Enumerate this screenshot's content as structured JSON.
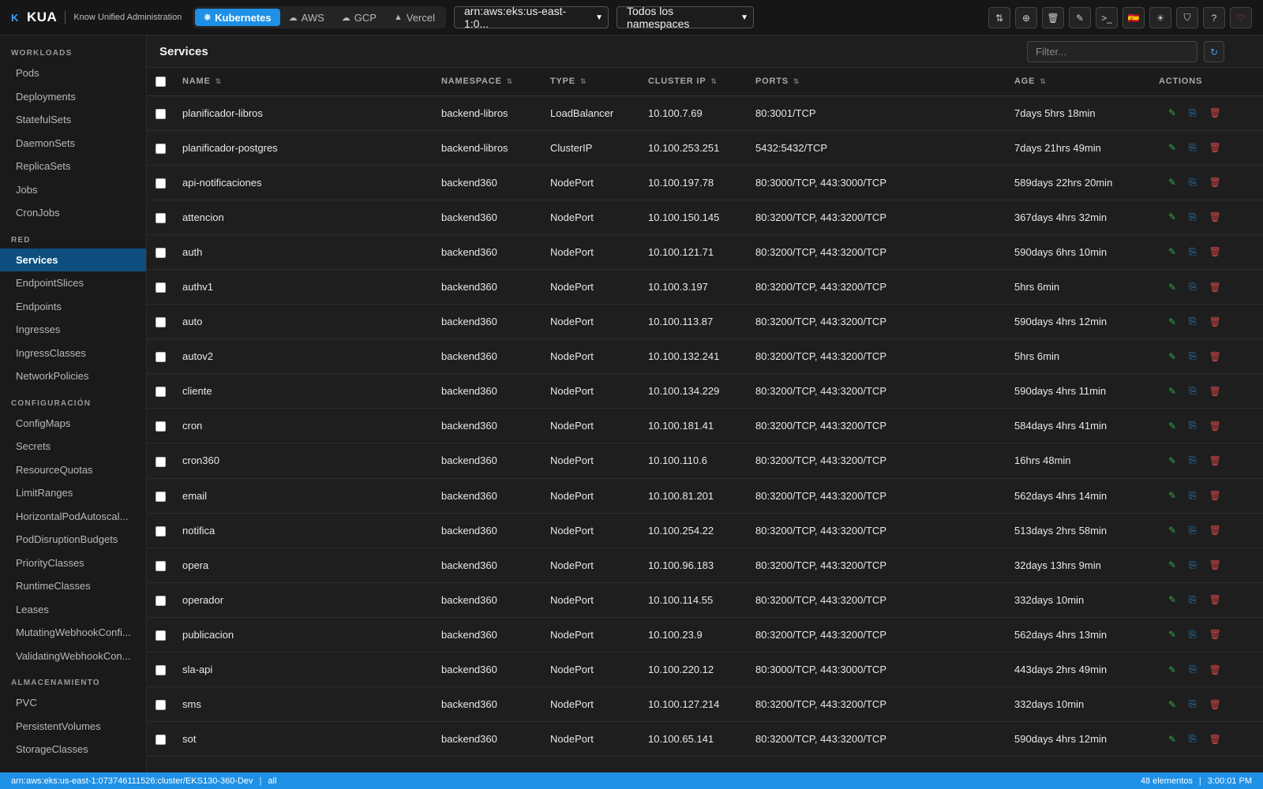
{
  "app": {
    "logo": "K",
    "name": "KUA",
    "subtitle": "Know Unified Administration"
  },
  "providers": [
    {
      "label": "Kubernetes",
      "icon": "⎈"
    },
    {
      "label": "AWS",
      "icon": "☁"
    },
    {
      "label": "GCP",
      "icon": "☁"
    },
    {
      "label": "Vercel",
      "icon": "▲"
    }
  ],
  "cluster_select": "arn:aws:eks:us-east-1:0...",
  "namespace_select": "Todos los namespaces",
  "toolbar_icons": [
    "⇅",
    "⊕",
    "🗑",
    "✎",
    ">_",
    "🇪🇸",
    "☀",
    "⛉",
    "?",
    "♡"
  ],
  "sidebar": {
    "sections": [
      {
        "title": "WORKLOADS",
        "items": [
          "Pods",
          "Deployments",
          "StatefulSets",
          "DaemonSets",
          "ReplicaSets",
          "Jobs",
          "CronJobs"
        ]
      },
      {
        "title": "RED",
        "items": [
          "Services",
          "EndpointSlices",
          "Endpoints",
          "Ingresses",
          "IngressClasses",
          "NetworkPolicies"
        ]
      },
      {
        "title": "CONFIGURACIÓN",
        "items": [
          "ConfigMaps",
          "Secrets",
          "ResourceQuotas",
          "LimitRanges",
          "HorizontalPodAutoscal...",
          "PodDisruptionBudgets",
          "PriorityClasses",
          "RuntimeClasses",
          "Leases",
          "MutatingWebhookConfi...",
          "ValidatingWebhookCon..."
        ]
      },
      {
        "title": "ALMACENAMIENTO",
        "items": [
          "PVC",
          "PersistentVolumes",
          "StorageClasses"
        ]
      }
    ],
    "active": "Services"
  },
  "main": {
    "title": "Services",
    "filter_placeholder": "Filter...",
    "refresh_icon": "↻"
  },
  "table": {
    "columns": [
      "NAME",
      "NAMESPACE",
      "TYPE",
      "CLUSTER IP",
      "PORTS",
      "AGE",
      "ACTIONS"
    ],
    "sort_icon": "⇅",
    "action_icons": {
      "edit": "✎",
      "describe": "⎘",
      "delete": "🗑"
    },
    "rows": [
      {
        "name": "planificador-libros",
        "namespace": "backend-libros",
        "type": "LoadBalancer",
        "ip": "10.100.7.69",
        "ports": "80:3001/TCP",
        "age": "7days 5hrs 18min"
      },
      {
        "name": "planificador-postgres",
        "namespace": "backend-libros",
        "type": "ClusterIP",
        "ip": "10.100.253.251",
        "ports": "5432:5432/TCP",
        "age": "7days 21hrs 49min"
      },
      {
        "name": "api-notificaciones",
        "namespace": "backend360",
        "type": "NodePort",
        "ip": "10.100.197.78",
        "ports": "80:3000/TCP, 443:3000/TCP",
        "age": "589days 22hrs 20min"
      },
      {
        "name": "attencion",
        "namespace": "backend360",
        "type": "NodePort",
        "ip": "10.100.150.145",
        "ports": "80:3200/TCP, 443:3200/TCP",
        "age": "367days 4hrs 32min"
      },
      {
        "name": "auth",
        "namespace": "backend360",
        "type": "NodePort",
        "ip": "10.100.121.71",
        "ports": "80:3200/TCP, 443:3200/TCP",
        "age": "590days 6hrs 10min"
      },
      {
        "name": "authv1",
        "namespace": "backend360",
        "type": "NodePort",
        "ip": "10.100.3.197",
        "ports": "80:3200/TCP, 443:3200/TCP",
        "age": "5hrs 6min"
      },
      {
        "name": "auto",
        "namespace": "backend360",
        "type": "NodePort",
        "ip": "10.100.113.87",
        "ports": "80:3200/TCP, 443:3200/TCP",
        "age": "590days 4hrs 12min"
      },
      {
        "name": "autov2",
        "namespace": "backend360",
        "type": "NodePort",
        "ip": "10.100.132.241",
        "ports": "80:3200/TCP, 443:3200/TCP",
        "age": "5hrs 6min"
      },
      {
        "name": "cliente",
        "namespace": "backend360",
        "type": "NodePort",
        "ip": "10.100.134.229",
        "ports": "80:3200/TCP, 443:3200/TCP",
        "age": "590days 4hrs 11min"
      },
      {
        "name": "cron",
        "namespace": "backend360",
        "type": "NodePort",
        "ip": "10.100.181.41",
        "ports": "80:3200/TCP, 443:3200/TCP",
        "age": "584days 4hrs 41min"
      },
      {
        "name": "cron360",
        "namespace": "backend360",
        "type": "NodePort",
        "ip": "10.100.110.6",
        "ports": "80:3200/TCP, 443:3200/TCP",
        "age": "16hrs 48min"
      },
      {
        "name": "email",
        "namespace": "backend360",
        "type": "NodePort",
        "ip": "10.100.81.201",
        "ports": "80:3200/TCP, 443:3200/TCP",
        "age": "562days 4hrs 14min"
      },
      {
        "name": "notifica",
        "namespace": "backend360",
        "type": "NodePort",
        "ip": "10.100.254.22",
        "ports": "80:3200/TCP, 443:3200/TCP",
        "age": "513days 2hrs 58min"
      },
      {
        "name": "opera",
        "namespace": "backend360",
        "type": "NodePort",
        "ip": "10.100.96.183",
        "ports": "80:3200/TCP, 443:3200/TCP",
        "age": "32days 13hrs 9min"
      },
      {
        "name": "operador",
        "namespace": "backend360",
        "type": "NodePort",
        "ip": "10.100.114.55",
        "ports": "80:3200/TCP, 443:3200/TCP",
        "age": "332days 10min"
      },
      {
        "name": "publicacion",
        "namespace": "backend360",
        "type": "NodePort",
        "ip": "10.100.23.9",
        "ports": "80:3200/TCP, 443:3200/TCP",
        "age": "562days 4hrs 13min"
      },
      {
        "name": "sla-api",
        "namespace": "backend360",
        "type": "NodePort",
        "ip": "10.100.220.12",
        "ports": "80:3000/TCP, 443:3000/TCP",
        "age": "443days 2hrs 49min"
      },
      {
        "name": "sms",
        "namespace": "backend360",
        "type": "NodePort",
        "ip": "10.100.127.214",
        "ports": "80:3200/TCP, 443:3200/TCP",
        "age": "332days 10min"
      },
      {
        "name": "sot",
        "namespace": "backend360",
        "type": "NodePort",
        "ip": "10.100.65.141",
        "ports": "80:3200/TCP, 443:3200/TCP",
        "age": "590days 4hrs 12min"
      }
    ]
  },
  "statusbar": {
    "cluster": "arn:aws:eks:us-east-1:073746111526:cluster/EKS130-360-Dev",
    "separator": "|",
    "namespace": "all",
    "count": "48 elementos",
    "time": "3:00:01 PM"
  },
  "colors": {
    "accent": "#1e90e6",
    "active_nav": "#0e4f7f",
    "edit": "#2faa4a",
    "delete": "#d24646"
  }
}
